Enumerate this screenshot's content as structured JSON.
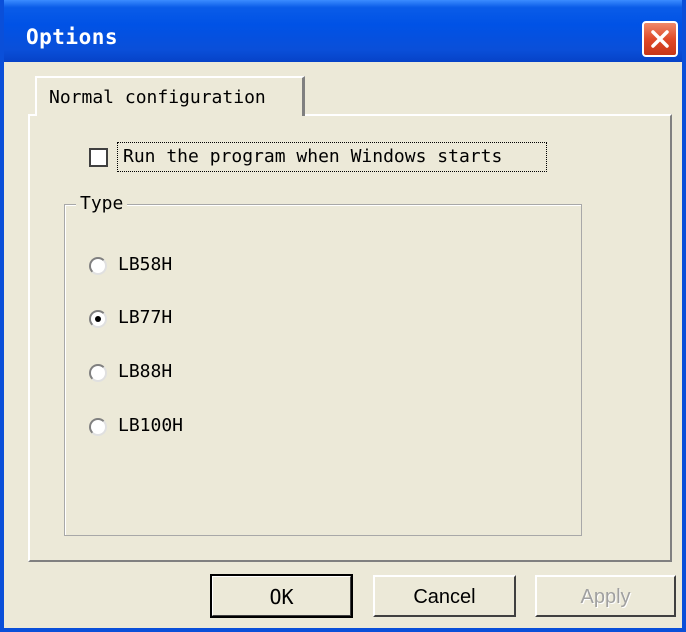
{
  "window": {
    "title": "Options"
  },
  "tabs": [
    {
      "label": "Normal configuration",
      "selected": true
    }
  ],
  "startup": {
    "label": "Run the program when Windows starts",
    "checked": false
  },
  "type_group": {
    "label": "Type",
    "options": [
      {
        "label": "LB58H",
        "selected": false
      },
      {
        "label": "LB77H",
        "selected": true
      },
      {
        "label": "LB88H",
        "selected": false
      },
      {
        "label": "LB100H",
        "selected": false
      }
    ]
  },
  "buttons": {
    "ok": "OK",
    "cancel": "Cancel",
    "apply": "Apply"
  },
  "colors": {
    "titlebar": "#0a4fd9",
    "close": "#e04a2a",
    "dialog_bg": "#ece9d8"
  },
  "icons": {
    "close": "close-icon"
  }
}
